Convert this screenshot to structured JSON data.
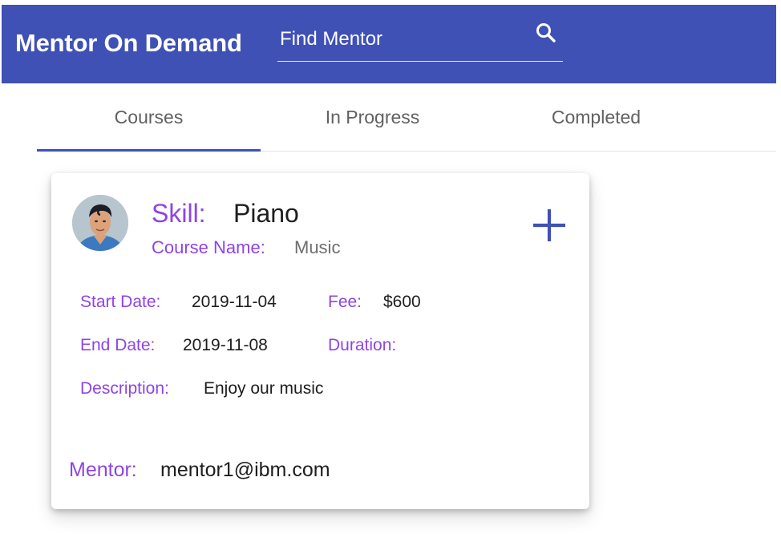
{
  "app": {
    "title": "Mentor On Demand",
    "brand_color": "#3f51b5",
    "accent_color": "#8e44e6"
  },
  "search": {
    "placeholder": "Find Mentor",
    "value": "",
    "icon": "search-icon"
  },
  "tabs": [
    {
      "label": "Courses",
      "active": true
    },
    {
      "label": "In Progress",
      "active": false
    },
    {
      "label": "Completed",
      "active": false
    }
  ],
  "course_card": {
    "avatar_icon": "mentor-avatar",
    "skill_label": "Skill:",
    "skill_value": "Piano",
    "course_name_label": "Course Name:",
    "course_name_value": "Music",
    "add_icon": "plus-icon",
    "start_date_label": "Start Date:",
    "start_date_value": "2019-11-04",
    "fee_label": "Fee:",
    "fee_value": "$600",
    "end_date_label": "End Date:",
    "end_date_value": "2019-11-08",
    "duration_label": "Duration:",
    "duration_value": "",
    "description_label": "Description:",
    "description_value": "Enjoy our music",
    "mentor_label": "Mentor:",
    "mentor_value": "mentor1@ibm.com"
  }
}
